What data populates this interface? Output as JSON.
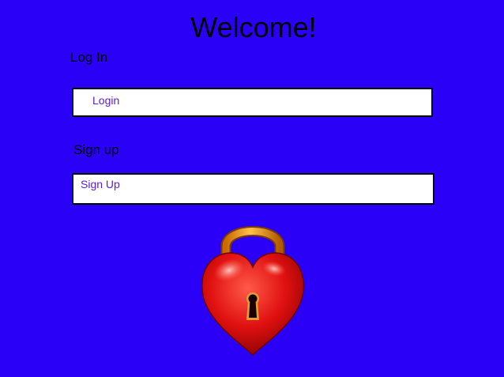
{
  "page": {
    "title": "Welcome!",
    "background_color": "#2a00f6"
  },
  "login": {
    "section_label": "Log In",
    "link_label": "Login"
  },
  "signup": {
    "section_label": "Sign up",
    "link_label": "Sign Up"
  },
  "image": {
    "icon": "heart-padlock-icon"
  },
  "colors": {
    "link": "#5a1ad6",
    "box_fill": "#ffffff",
    "box_border": "#000000"
  }
}
